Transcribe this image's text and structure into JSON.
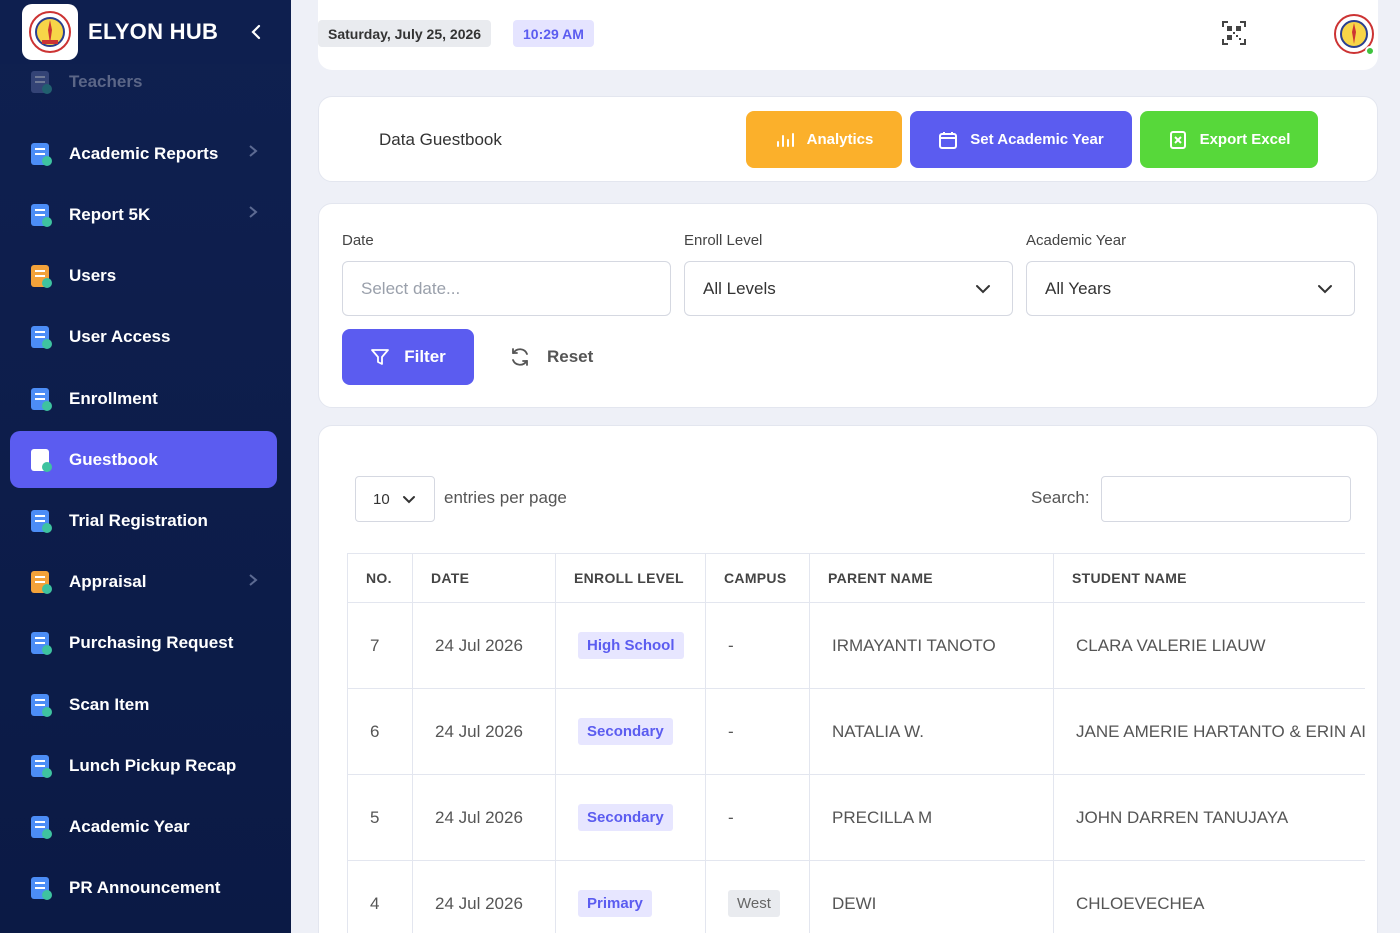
{
  "sidebar": {
    "brand": "ELYON HUB",
    "items": [
      {
        "label": "Teachers",
        "icon": "teachers-icon",
        "chevron": false,
        "state": "faded"
      },
      {
        "label": "Academic Reports",
        "icon": "academic-reports-icon",
        "chevron": true,
        "state": ""
      },
      {
        "label": "Report 5K",
        "icon": "report-icon",
        "chevron": true,
        "state": ""
      },
      {
        "label": "Users",
        "icon": "users-icon",
        "chevron": false,
        "state": ""
      },
      {
        "label": "User Access",
        "icon": "user-access-icon",
        "chevron": false,
        "state": ""
      },
      {
        "label": "Enrollment",
        "icon": "enrollment-icon",
        "chevron": false,
        "state": ""
      },
      {
        "label": "Guestbook",
        "icon": "guestbook-icon",
        "chevron": false,
        "state": "active"
      },
      {
        "label": "Trial Registration",
        "icon": "trial-registration-icon",
        "chevron": false,
        "state": ""
      },
      {
        "label": "Appraisal",
        "icon": "appraisal-icon",
        "chevron": true,
        "state": ""
      },
      {
        "label": "Purchasing Request",
        "icon": "cart-icon",
        "chevron": false,
        "state": ""
      },
      {
        "label": "Scan Item",
        "icon": "scan-icon",
        "chevron": false,
        "state": ""
      },
      {
        "label": "Lunch Pickup Recap",
        "icon": "lunch-icon",
        "chevron": false,
        "state": ""
      },
      {
        "label": "Academic Year",
        "icon": "calendar-icon",
        "chevron": false,
        "state": ""
      },
      {
        "label": "PR Announcement",
        "icon": "megaphone-icon",
        "chevron": false,
        "state": ""
      }
    ]
  },
  "topbar": {
    "date": "Saturday, July 25, 2026",
    "time": "10:29 AM"
  },
  "header": {
    "title": "Data Guestbook",
    "analytics_label": "Analytics",
    "set_year_label": "Set Academic Year",
    "export_label": "Export Excel"
  },
  "filters": {
    "date_label": "Date",
    "date_placeholder": "Select date...",
    "level_label": "Enroll Level",
    "level_value": "All Levels",
    "year_label": "Academic Year",
    "year_value": "All Years",
    "filter_label": "Filter",
    "reset_label": "Reset"
  },
  "table": {
    "page_length": "10",
    "length_label": "entries per page",
    "search_label": "Search:",
    "columns": [
      "NO.",
      "DATE",
      "ENROLL LEVEL",
      "CAMPUS",
      "PARENT NAME",
      "STUDENT NAME"
    ],
    "rows": [
      {
        "no": "7",
        "date": "24 Jul 2026",
        "level": "High School",
        "campus": "-",
        "parent": "IRMAYANTI TANOTO",
        "student": "CLARA VALERIE LIAUW"
      },
      {
        "no": "6",
        "date": "24 Jul 2026",
        "level": "Secondary",
        "campus": "-",
        "parent": "NATALIA W.",
        "student": "JANE AMERIE HARTANTO & ERIN AI"
      },
      {
        "no": "5",
        "date": "24 Jul 2026",
        "level": "Secondary",
        "campus": "-",
        "parent": "PRECILLA M",
        "student": "JOHN DARREN TANUJAYA"
      },
      {
        "no": "4",
        "date": "24 Jul 2026",
        "level": "Primary",
        "campus": "West",
        "parent": "DEWI",
        "student": "CHLOEVECHEA"
      }
    ]
  },
  "colors": {
    "accent": "#5b5cf0",
    "analytics": "#fbb02b",
    "export": "#57d83a",
    "sidebar": "#0f2050"
  }
}
